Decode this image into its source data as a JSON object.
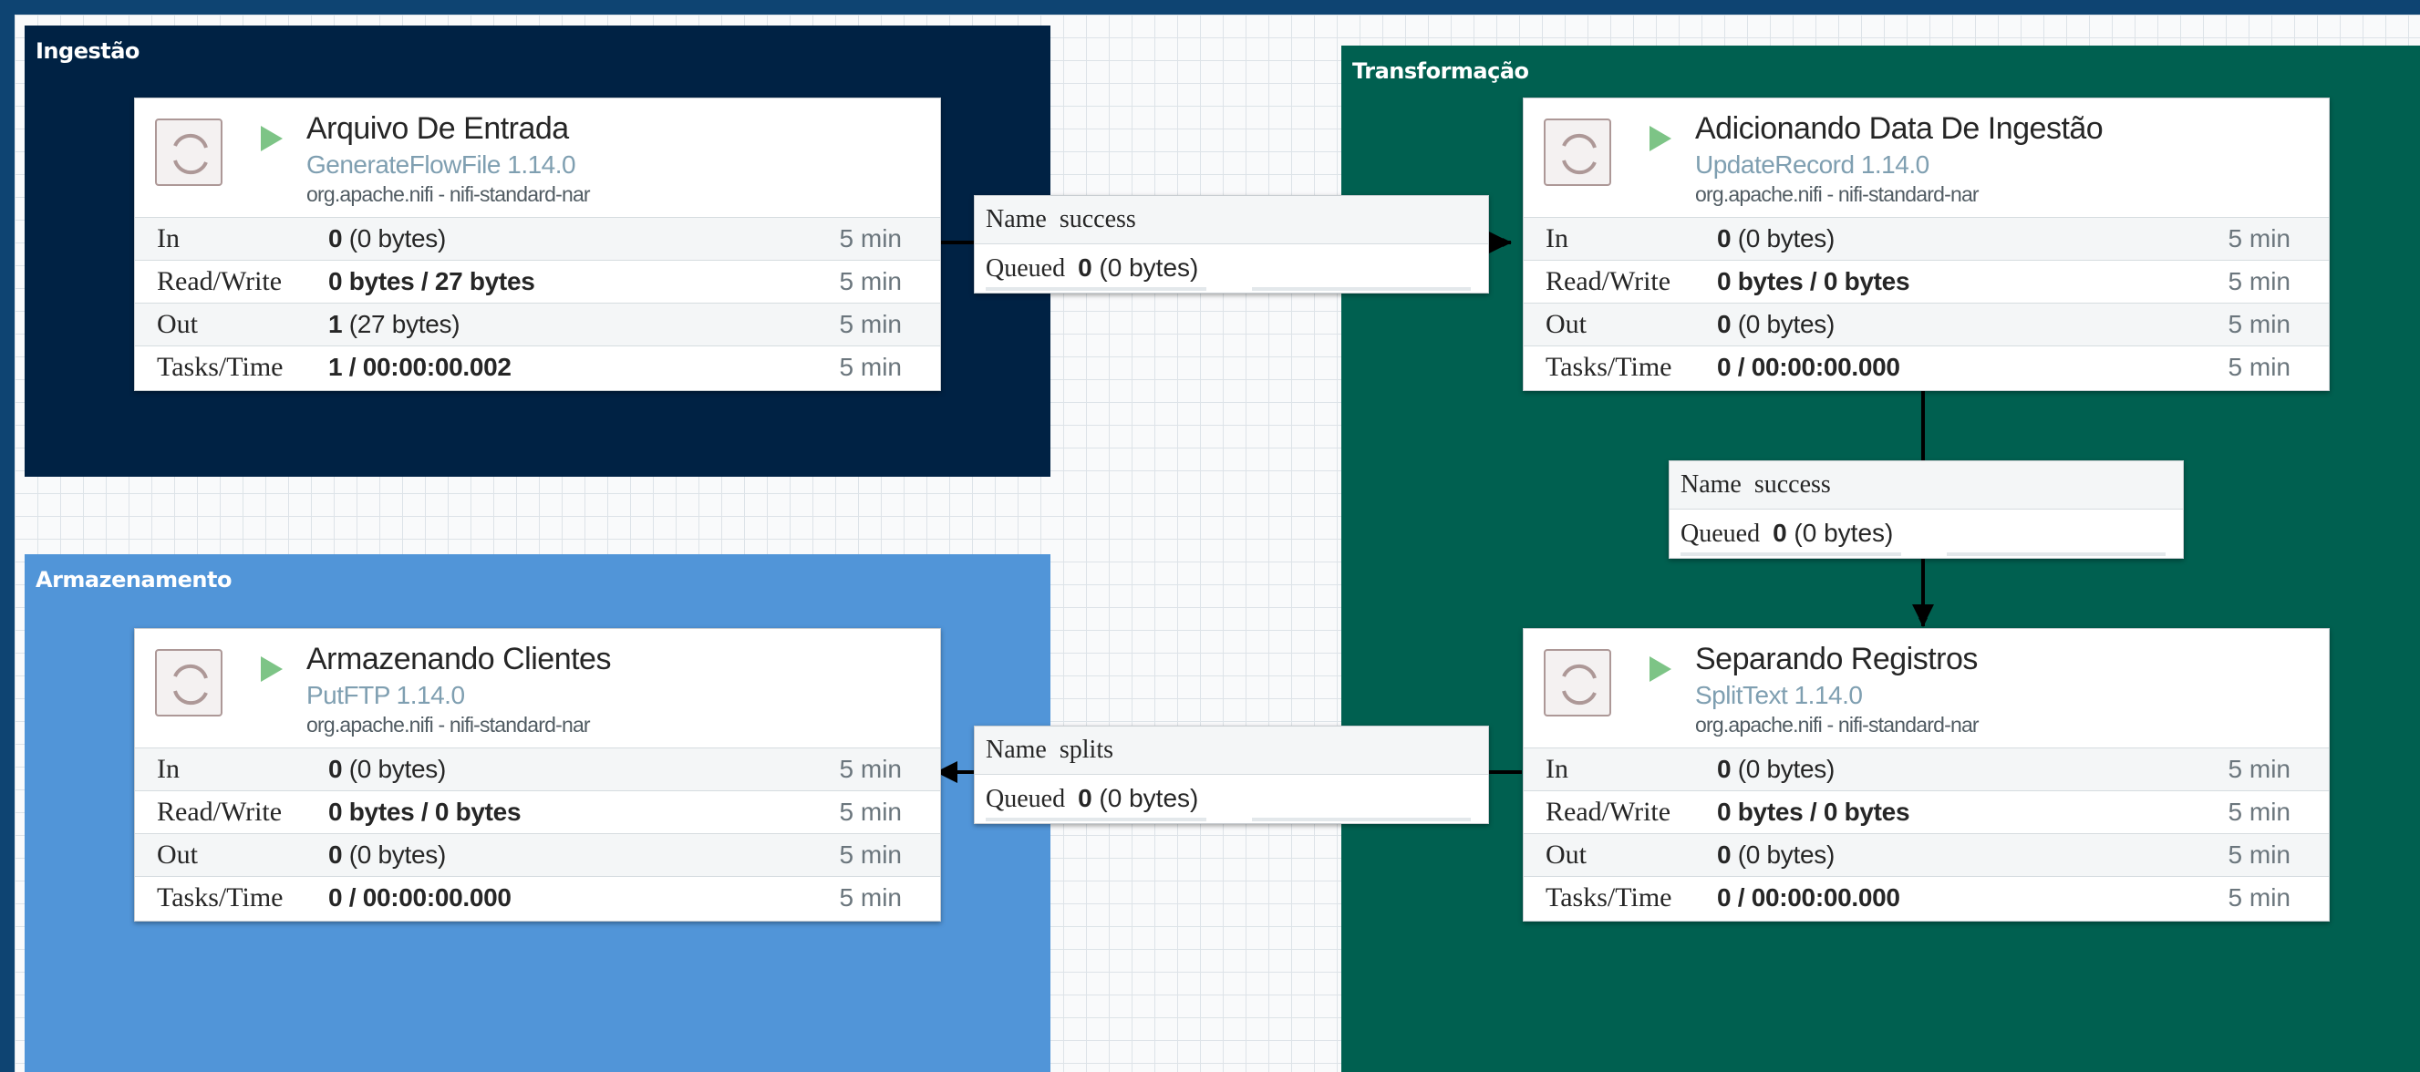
{
  "groups": {
    "ingestao": "Ingestão",
    "armazenamento": "Armazenamento",
    "transformacao": "Transformação"
  },
  "stat_labels": {
    "in": "In",
    "read_write": "Read/Write",
    "out": "Out",
    "tasks_time": "Tasks/Time"
  },
  "processors": {
    "arquivo": {
      "name": "Arquivo De Entrada",
      "type": "GenerateFlowFile 1.14.0",
      "bundle": "org.apache.nifi - nifi-standard-nar",
      "in_count": "0",
      "in_bytes": " (0 bytes)",
      "rw": "0 bytes / 27 bytes",
      "out_count": "1",
      "out_bytes": " (27 bytes)",
      "tasks": "1 / 00:00:00.002",
      "window": "5 min"
    },
    "armazenando": {
      "name": "Armazenando Clientes",
      "type": "PutFTP 1.14.0",
      "bundle": "org.apache.nifi - nifi-standard-nar",
      "in_count": "0",
      "in_bytes": " (0 bytes)",
      "rw": "0 bytes / 0 bytes",
      "out_count": "0",
      "out_bytes": " (0 bytes)",
      "tasks": "0 / 00:00:00.000",
      "window": "5 min"
    },
    "adicionando": {
      "name": "Adicionando Data De Ingestão",
      "type": "UpdateRecord 1.14.0",
      "bundle": "org.apache.nifi - nifi-standard-nar",
      "in_count": "0",
      "in_bytes": " (0 bytes)",
      "rw": "0 bytes / 0 bytes",
      "out_count": "0",
      "out_bytes": " (0 bytes)",
      "tasks": "0 / 00:00:00.000",
      "window": "5 min"
    },
    "separando": {
      "name": "Separando Registros",
      "type": "SplitText 1.14.0",
      "bundle": "org.apache.nifi - nifi-standard-nar",
      "in_count": "0",
      "in_bytes": " (0 bytes)",
      "rw": "0 bytes / 0 bytes",
      "out_count": "0",
      "out_bytes": " (0 bytes)",
      "tasks": "0 / 00:00:00.000",
      "window": "5 min"
    }
  },
  "connections": {
    "name_label": "Name",
    "queued_label": "Queued",
    "c1": {
      "name": "success",
      "queued_count": "0",
      "queued_bytes": " (0 bytes)"
    },
    "c2": {
      "name": "success",
      "queued_count": "0",
      "queued_bytes": " (0 bytes)"
    },
    "c3": {
      "name": "splits",
      "queued_count": "0",
      "queued_bytes": " (0 bytes)"
    }
  },
  "colors": {
    "ingestao_bg": "#002244",
    "armazenamento_bg": "#5195d8",
    "transformacao_bg": "#006050",
    "run_icon": "#7dc486"
  },
  "icons": {
    "processor": "processor-icon",
    "run": "play-icon"
  }
}
